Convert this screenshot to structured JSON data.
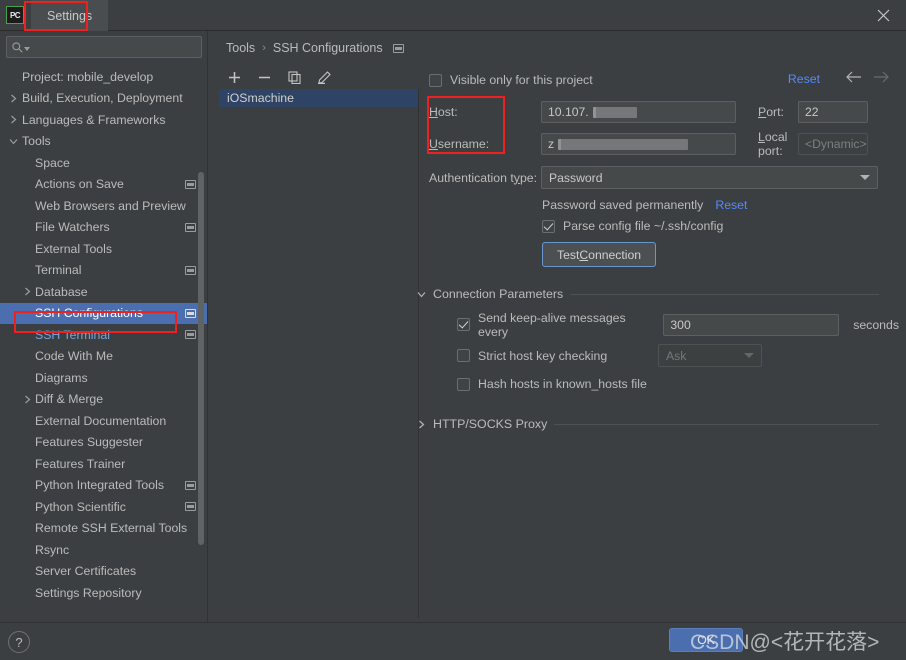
{
  "window": {
    "app_icon": "PC",
    "tab_title": "Settings",
    "close_icon": "close-icon"
  },
  "sidebar": {
    "search": {
      "value": "",
      "placeholder": "",
      "icon": "search-icon"
    },
    "items": [
      {
        "label": "Project: mobile_develop",
        "level": 0,
        "arrow": "none",
        "selected": false,
        "badge": false,
        "blue": false
      },
      {
        "label": "Build, Execution, Deployment",
        "level": 0,
        "arrow": "right",
        "selected": false,
        "badge": false,
        "blue": false
      },
      {
        "label": "Languages & Frameworks",
        "level": 0,
        "arrow": "right",
        "selected": false,
        "badge": false,
        "blue": false
      },
      {
        "label": "Tools",
        "level": 0,
        "arrow": "down",
        "selected": false,
        "badge": false,
        "blue": false
      },
      {
        "label": "Space",
        "level": 1,
        "arrow": "none",
        "selected": false,
        "badge": false,
        "blue": false
      },
      {
        "label": "Actions on Save",
        "level": 1,
        "arrow": "none",
        "selected": false,
        "badge": true,
        "blue": false
      },
      {
        "label": "Web Browsers and Preview",
        "level": 1,
        "arrow": "none",
        "selected": false,
        "badge": false,
        "blue": false
      },
      {
        "label": "File Watchers",
        "level": 1,
        "arrow": "none",
        "selected": false,
        "badge": true,
        "blue": false
      },
      {
        "label": "External Tools",
        "level": 1,
        "arrow": "none",
        "selected": false,
        "badge": false,
        "blue": false
      },
      {
        "label": "Terminal",
        "level": 1,
        "arrow": "none",
        "selected": false,
        "badge": true,
        "blue": false
      },
      {
        "label": "Database",
        "level": 1,
        "arrow": "right",
        "selected": false,
        "badge": false,
        "blue": false
      },
      {
        "label": "SSH Configurations",
        "level": 1,
        "arrow": "none",
        "selected": true,
        "badge": true,
        "blue": false
      },
      {
        "label": "SSH Terminal",
        "level": 1,
        "arrow": "none",
        "selected": false,
        "badge": true,
        "blue": true
      },
      {
        "label": "Code With Me",
        "level": 1,
        "arrow": "none",
        "selected": false,
        "badge": false,
        "blue": false
      },
      {
        "label": "Diagrams",
        "level": 1,
        "arrow": "none",
        "selected": false,
        "badge": false,
        "blue": false
      },
      {
        "label": "Diff & Merge",
        "level": 1,
        "arrow": "right",
        "selected": false,
        "badge": false,
        "blue": false
      },
      {
        "label": "External Documentation",
        "level": 1,
        "arrow": "none",
        "selected": false,
        "badge": false,
        "blue": false
      },
      {
        "label": "Features Suggester",
        "level": 1,
        "arrow": "none",
        "selected": false,
        "badge": false,
        "blue": false
      },
      {
        "label": "Features Trainer",
        "level": 1,
        "arrow": "none",
        "selected": false,
        "badge": false,
        "blue": false
      },
      {
        "label": "Python Integrated Tools",
        "level": 1,
        "arrow": "none",
        "selected": false,
        "badge": true,
        "blue": false
      },
      {
        "label": "Python Scientific",
        "level": 1,
        "arrow": "none",
        "selected": false,
        "badge": true,
        "blue": false
      },
      {
        "label": "Remote SSH External Tools",
        "level": 1,
        "arrow": "none",
        "selected": false,
        "badge": false,
        "blue": false
      },
      {
        "label": "Rsync",
        "level": 1,
        "arrow": "none",
        "selected": false,
        "badge": false,
        "blue": false
      },
      {
        "label": "Server Certificates",
        "level": 1,
        "arrow": "none",
        "selected": false,
        "badge": false,
        "blue": false
      },
      {
        "label": "Settings Repository",
        "level": 1,
        "arrow": "none",
        "selected": false,
        "badge": false,
        "blue": false
      }
    ]
  },
  "main": {
    "breadcrumb": {
      "root": "Tools",
      "separator": "›",
      "current": "SSH Configurations"
    },
    "reset_label": "Reset",
    "nav_back_icon": "arrow-left-icon",
    "nav_forward_icon": "arrow-right-icon",
    "toolbar": {
      "add_icon": "plus-icon",
      "remove_icon": "minus-icon",
      "copy_icon": "copy-icon",
      "edit_icon": "pencil-icon"
    },
    "configurations": [
      {
        "name": "iOSmachine",
        "selected": true
      }
    ],
    "form": {
      "visible_only_label": "Visible only for this project",
      "visible_only_checked": false,
      "host_label": "Host:",
      "host_value": "10.107.",
      "host_redacted": true,
      "port_label": "Port:",
      "port_value": "22",
      "username_label": "Username:",
      "username_value": "z",
      "username_redacted": true,
      "local_port_label": "Local port:",
      "local_port_placeholder": "<Dynamic>",
      "auth_type_label": "Authentication type:",
      "auth_type_value": "Password",
      "password_saved_text": "Password saved permanently",
      "password_reset_link": "Reset",
      "parse_config_label": "Parse config file ~/.ssh/config",
      "parse_config_checked": true,
      "test_connection_label": "Test Connection"
    },
    "connection_parameters": {
      "section_title": "Connection Parameters",
      "expanded": true,
      "keepalive_label": "Send keep-alive messages every",
      "keepalive_checked": true,
      "keepalive_value": "300",
      "keepalive_unit": "seconds",
      "strict_host_label": "Strict host key checking",
      "strict_host_checked": false,
      "strict_host_value": "Ask",
      "hash_hosts_label": "Hash hosts in known_hosts file",
      "hash_hosts_checked": false
    },
    "proxy_section": {
      "title": "HTTP/SOCKS Proxy",
      "expanded": false
    }
  },
  "footer": {
    "help_label": "?",
    "ok_label": "OK",
    "watermark": "CSDN@<花开花落>"
  },
  "colors": {
    "background": "#3c3f41",
    "selection": "#4b6eaf",
    "link": "#548af7",
    "annotation": "#ef2020",
    "list_selection": "#2f4464"
  }
}
